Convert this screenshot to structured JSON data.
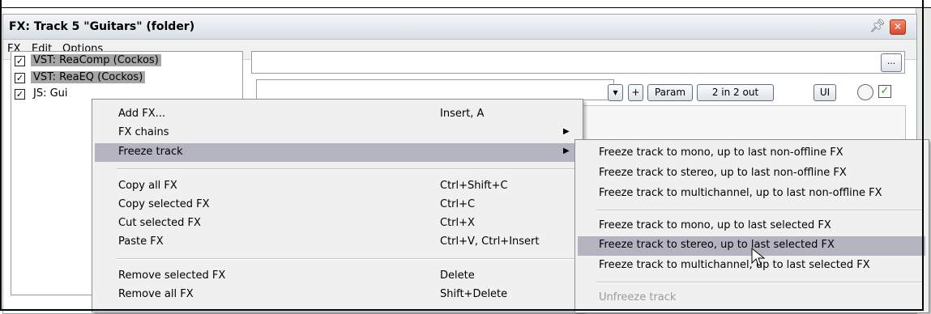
{
  "window": {
    "title": "FX: Track 5 \"Guitars\" (folder)",
    "pin_icon": "pin-icon",
    "close_icon": "close-icon"
  },
  "menubar": [
    "FX",
    "Edit",
    "Options"
  ],
  "fx_list": [
    {
      "label": "VST: ReaComp (Cockos)",
      "checked": true,
      "selected": true
    },
    {
      "label": "VST: ReaEQ (Cockos)",
      "checked": true,
      "selected": true
    },
    {
      "label": "JS: Gui",
      "checked": true,
      "selected": false
    }
  ],
  "controls": {
    "dots": "...",
    "plus": "+",
    "param": "Param",
    "io": "2 in 2 out",
    "ui": "UI"
  },
  "context_menu": {
    "items": [
      {
        "label": "Add FX...",
        "shortcut": "Insert, A"
      },
      {
        "label": "FX chains",
        "shortcut": "",
        "submenu": true
      },
      {
        "label": "Freeze track",
        "shortcut": "",
        "submenu": true,
        "highlighted": true
      },
      {
        "label": "Copy all FX",
        "shortcut": "Ctrl+Shift+C"
      },
      {
        "label": "Copy selected FX",
        "shortcut": "Ctrl+C"
      },
      {
        "label": "Cut selected FX",
        "shortcut": "Ctrl+X"
      },
      {
        "label": "Paste FX",
        "shortcut": "Ctrl+V, Ctrl+Insert"
      },
      {
        "label": "Remove selected FX",
        "shortcut": "Delete"
      },
      {
        "label": "Remove all FX",
        "shortcut": "Shift+Delete"
      }
    ]
  },
  "freeze_submenu": {
    "items": [
      {
        "label": "Freeze track to mono, up to last non-offline FX"
      },
      {
        "label": "Freeze track to stereo, up to last non-offline FX"
      },
      {
        "label": "Freeze track to multichannel, up to last non-offline FX"
      },
      {
        "label": "Freeze track to mono, up to last selected FX"
      },
      {
        "label": "Freeze track to stereo, up to last selected FX",
        "highlighted": true
      },
      {
        "label": "Freeze track to multichannel, up to last selected FX"
      },
      {
        "label": "Unfreeze track",
        "disabled": true
      }
    ]
  },
  "colors": {
    "menu_highlight": "#b4b4c0",
    "selected_fx": "#a6a6a6",
    "close_button": "#d84a2a",
    "disabled_text": "#9a9a9a"
  }
}
